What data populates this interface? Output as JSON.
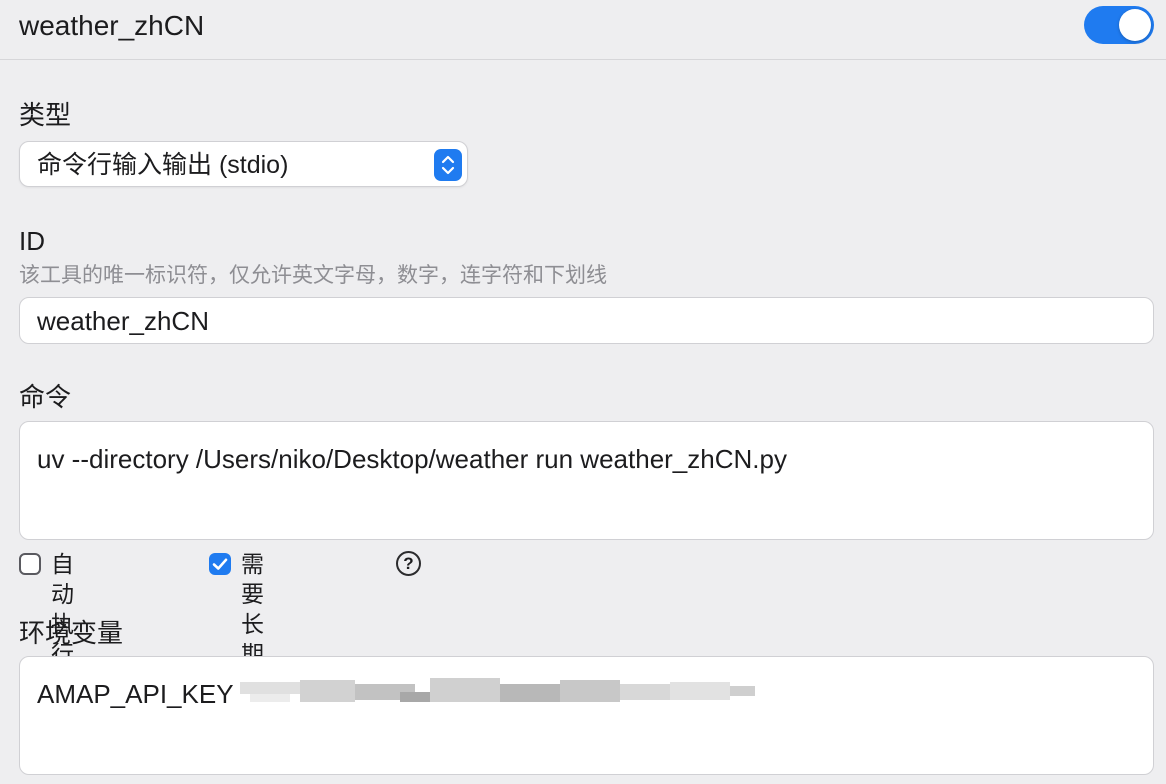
{
  "header": {
    "title": "weather_zhCN",
    "enabled": true
  },
  "type_field": {
    "label": "类型",
    "value": "命令行输入输出 (stdio)"
  },
  "id_field": {
    "label": "ID",
    "hint": "该工具的唯一标识符，仅允许英文字母，数字，连字符和下划线",
    "value": "weather_zhCN"
  },
  "command_field": {
    "label": "命令",
    "value": "uv --directory /Users/niko/Desktop/weather run weather_zhCN.py"
  },
  "options": {
    "auto_execute": {
      "label": "自动执行工具",
      "checked": false
    },
    "long_running": {
      "label": "需要长期运行",
      "checked": true
    },
    "help_glyph": "?"
  },
  "env_field": {
    "label": "环境变量",
    "value": "AMAP_API_KEY"
  },
  "colors": {
    "accent": "#1f7bf0",
    "background": "#eeeef0"
  }
}
